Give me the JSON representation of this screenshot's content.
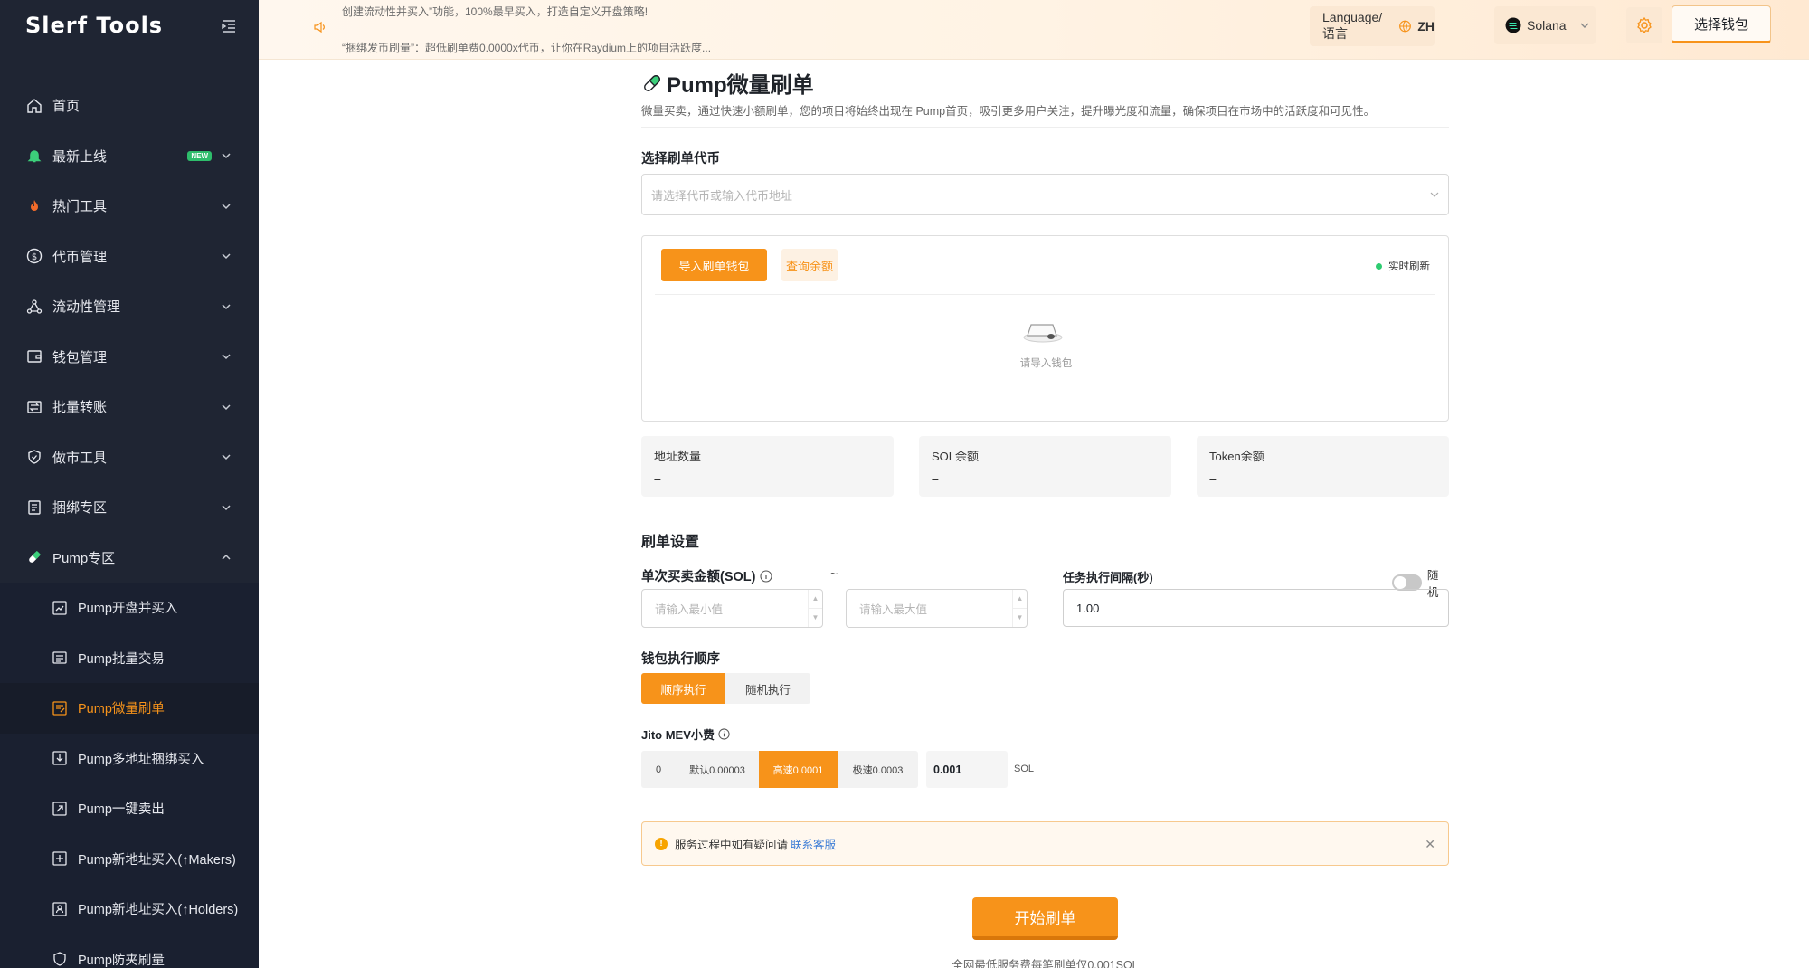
{
  "app": {
    "logo": "Slerf Tools"
  },
  "sidebar": {
    "items": [
      {
        "label": "首页",
        "icon": "home-icon"
      },
      {
        "label": "最新上线",
        "icon": "bell-icon",
        "badge": "NEW"
      },
      {
        "label": "热门工具",
        "icon": "fire-icon"
      },
      {
        "label": "代币管理",
        "icon": "dollar-circle-icon"
      },
      {
        "label": "流动性管理",
        "icon": "network-icon"
      },
      {
        "label": "钱包管理",
        "icon": "wallet-icon"
      },
      {
        "label": "批量转账",
        "icon": "transfer-icon"
      },
      {
        "label": "做市工具",
        "icon": "shield-icon"
      },
      {
        "label": "捆绑专区",
        "icon": "bundle-icon"
      },
      {
        "label": "Pump专区",
        "icon": "pill-icon"
      }
    ],
    "sub_items": [
      {
        "label": "Pump开盘并买入"
      },
      {
        "label": "Pump批量交易"
      },
      {
        "label": "Pump微量刷单",
        "active": true
      },
      {
        "label": "Pump多地址捆绑买入"
      },
      {
        "label": "Pump一键卖出"
      },
      {
        "label": "Pump新地址买入(↑Makers)"
      },
      {
        "label": "Pump新地址买入(↑Holders)"
      },
      {
        "label": "Pump防夹刷量"
      }
    ]
  },
  "topbar": {
    "notice_line1": "创建流动性并买入”功能，100%最早买入，打造自定义开盘策略!",
    "notice_line2": "“捆绑发币刷量”：超低刷单费0.0000x代币，让你在Raydium上的项目活跃度...",
    "language_label": "Language/语言",
    "language_code": "ZH",
    "chain": "Solana",
    "wallet_button": "选择钱包"
  },
  "page": {
    "title": "Pump微量刷单",
    "description": "微量买卖，通过快速小额刷单，您的项目将始终出现在 Pump首页，吸引更多用户关注，提升曝光度和流量，确保项目在市场中的活跃度和可见性。",
    "token_select": {
      "label": "选择刷单代币",
      "placeholder": "请选择代币或输入代币地址"
    },
    "wallet_panel": {
      "import_button": "导入刷单钱包",
      "query_button": "查询余额",
      "live_label": "实时刷新",
      "empty_text": "请导入钱包"
    },
    "stats": [
      {
        "title": "地址数量",
        "value": "–"
      },
      {
        "title": "SOL余额",
        "value": "–"
      },
      {
        "title": "Token余额",
        "value": "–"
      }
    ],
    "settings": {
      "section_title": "刷单设置",
      "amount_label": "单次买卖金额(SOL)",
      "min_placeholder": "请输入最小值",
      "max_placeholder": "请输入最大值",
      "tilde": "~",
      "interval_label": "任务执行间隔(秒)",
      "random_label": "随机",
      "interval_value": "1.00",
      "order_label": "钱包执行顺序",
      "order_options": [
        "顺序执行",
        "随机执行"
      ],
      "order_selected": "顺序执行",
      "mev_label": "Jito MEV小费",
      "mev_options": [
        "0",
        "默认0.00003",
        "高速0.0001",
        "极速0.0003"
      ],
      "mev_selected": "高速0.0001",
      "mev_value": "0.001",
      "mev_unit": "SOL"
    },
    "alert": {
      "text": "服务过程中如有疑问请",
      "link": "联系客服"
    },
    "start_button": "开始刷单",
    "fee_note": "全网最低服务费每笔刷单仅0.001SOL"
  },
  "colors": {
    "accent": "#f7931a",
    "sidebar_bg": "#1f2533",
    "link": "#3a7bd5"
  }
}
